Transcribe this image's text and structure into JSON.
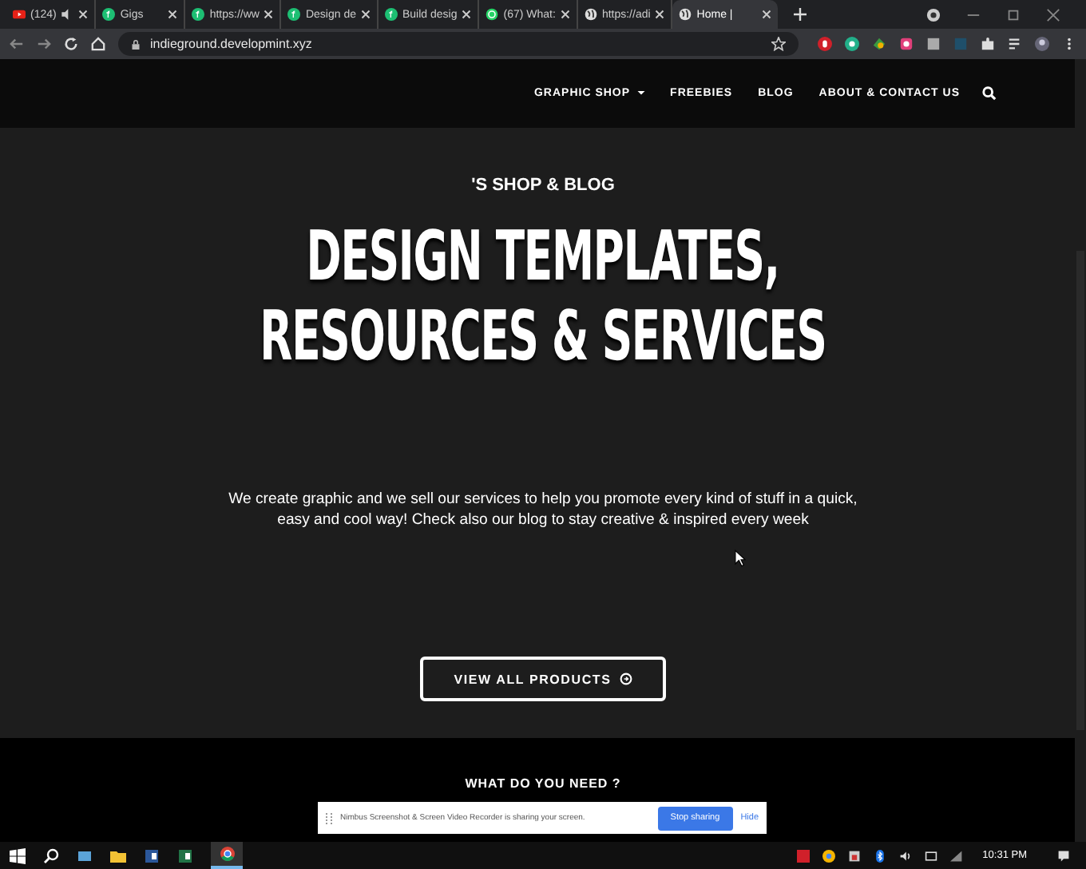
{
  "tabs": [
    {
      "kind": "video",
      "title": "(124)",
      "audio": true,
      "selected": false
    },
    {
      "kind": "market",
      "title": "Gigs",
      "audio": false,
      "selected": false
    },
    {
      "kind": "market",
      "title": "https://ww",
      "audio": false,
      "selected": false
    },
    {
      "kind": "market",
      "title": "Design de",
      "audio": false,
      "selected": false
    },
    {
      "kind": "market",
      "title": "Build desig",
      "audio": false,
      "selected": false
    },
    {
      "kind": "chat",
      "title": "(67) What:",
      "audio": false,
      "selected": false
    },
    {
      "kind": "web",
      "title": "https://adi",
      "audio": false,
      "selected": false
    },
    {
      "kind": "web",
      "title": "Home |",
      "audio": false,
      "selected": true
    }
  ],
  "address": "indieground.developmint.xyz",
  "nav": [
    {
      "label": "GRAPHIC SHOP",
      "dropdown": true
    },
    {
      "label": "FREEBIES",
      "dropdown": false
    },
    {
      "label": "BLOG",
      "dropdown": false
    },
    {
      "label": "ABOUT & CONTACT US",
      "dropdown": false
    }
  ],
  "hero": {
    "kicker": "'S SHOP & BLOG",
    "headline": [
      "DESIGN TEMPLATES,",
      "RESOURCES & SERVICES"
    ],
    "text": "We create graphic and we sell our services to help you promote every kind of stuff in a quick, easy and cool way! Check also our blog to stay creative & inspired every week",
    "button": "VIEW ALL PRODUCTS"
  },
  "section": {
    "kicker": "WHAT DO YOU NEED ?"
  },
  "share_bar": {
    "text": "Nimbus Screenshot & Screen Video Recorder is sharing your screen.",
    "stop": "Stop sharing",
    "hide": "Hide"
  },
  "taskbar": {
    "time": "10:31 PM"
  }
}
